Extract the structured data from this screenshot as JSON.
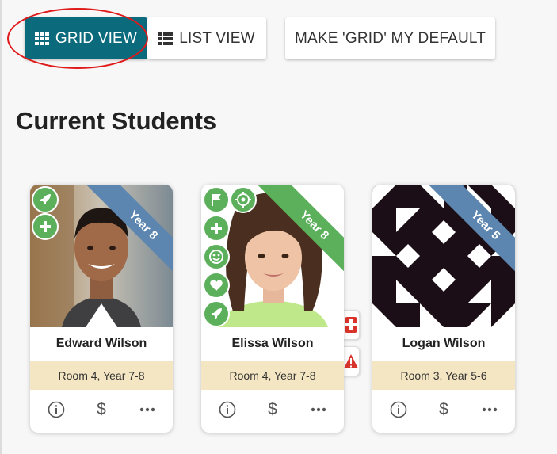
{
  "toolbar": {
    "grid_view_label": "GRID VIEW",
    "list_view_label": "LIST VIEW",
    "make_default_label": "MAKE 'GRID' MY DEFAULT"
  },
  "section": {
    "title": "Current Students"
  },
  "students": [
    {
      "name": "Edward Wilson",
      "room": "Room 4, Year 7-8",
      "year": "Year 8",
      "ribbon_color": "#5c86b0"
    },
    {
      "name": "Elissa Wilson",
      "room": "Room 4, Year 7-8",
      "year": "Year 8",
      "ribbon_color": "#5cb05c"
    },
    {
      "name": "Logan Wilson",
      "room": "Room 3, Year 5-6",
      "year": "Year 5",
      "ribbon_color": "#5c86b0"
    }
  ],
  "actions": {
    "fee_symbol": "$"
  },
  "colors": {
    "primary": "#0b6b7d",
    "highlight": "#e01a1a",
    "badge_green": "#5cb05c",
    "room_bg": "#f5e6c3",
    "alert_red": "#d9342b"
  }
}
